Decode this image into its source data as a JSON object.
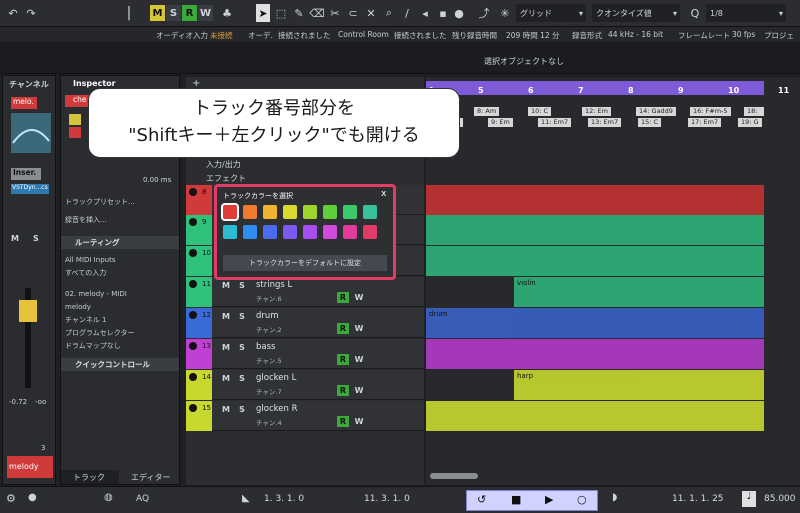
{
  "toolbar": {
    "m": "M",
    "s": "S",
    "r": "R",
    "w": "W",
    "grid": "グリッド",
    "quantize": "クオンタイズ値",
    "quantize_value": "1/8"
  },
  "status": {
    "audio_input_label": "オーディオ入力",
    "audio_input_value": "未接続",
    "audio_out_label": "オーデ.",
    "audio_out_value": "接続されました",
    "control_room_label": "Control Room",
    "control_room_value": "接続されました",
    "remaining_label": "残り録音時間",
    "remaining_value": "209 時間 12 分",
    "format_label": "録音形式",
    "format_value": "44 kHz - 16 bit",
    "framerate_label": "フレームレート",
    "framerate_value": "30 fps",
    "project_label": "プロジェクトの"
  },
  "info": {
    "no_selection": "選択オブジェクトなし"
  },
  "channel": {
    "title": "チャンネル",
    "name": "melo.",
    "insert": "Inser.",
    "plugin": "VSTDyn...cs",
    "volume": "-0.72",
    "pan": "-oo",
    "meter": "3",
    "track_name": "melody"
  },
  "inspector": {
    "title": "Inspector",
    "track_name": "che",
    "time": "0.00 ms",
    "preset": "トラックプリセット...",
    "pre_insert": "録音を挿入...",
    "routing": "ルーティング",
    "midi_in": "All MIDI Inputs",
    "all_inputs": "すべての入力",
    "midi_out": "02. melody - MIDI",
    "melody": "melody",
    "channel": "チャンネル 1",
    "program": "プログラムセレクター",
    "drum_map": "ドラムマップなし",
    "quick_controls": "クイックコントロール",
    "tab_track": "トラック",
    "tab_editor": "エディター"
  },
  "callout": {
    "line1": "トラック番号部分を",
    "line2": "\"Shiftキー＋左クリック\"でも開ける"
  },
  "picker": {
    "title": "トラックカラーを選択",
    "close": "x",
    "default_button": "トラックカラーをデフォルトに設定",
    "colors": [
      "#e23b3b",
      "#f07a2e",
      "#f0b32e",
      "#d9d92e",
      "#9fd62e",
      "#5bd03a",
      "#3ac86a",
      "#36c29a",
      "#2ebad0",
      "#2e8ef0",
      "#4a6af0",
      "#7a5af0",
      "#a84ef0",
      "#d04ae0",
      "#e23b9a",
      "#e23b66"
    ]
  },
  "rows": {
    "io": "入力/出力",
    "fx": "エフェクト"
  },
  "tracks": [
    {
      "num": "8",
      "name": "",
      "sub": "",
      "color": "#d03a3a"
    },
    {
      "num": "9",
      "name": "",
      "sub": "",
      "color": "#2ec27a"
    },
    {
      "num": "10",
      "name": "",
      "sub": "",
      "color": "#2ec27a"
    },
    {
      "num": "11",
      "name": "strings L",
      "sub": "チャン.6",
      "color": "#2ec27a"
    },
    {
      "num": "12",
      "name": "drum",
      "sub": "チャン.2",
      "color": "#3a6ad6"
    },
    {
      "num": "13",
      "name": "bass",
      "sub": "チャン.5",
      "color": "#c040d6"
    },
    {
      "num": "14",
      "name": "glocken L",
      "sub": "チャン.7",
      "color": "#c8d82e"
    },
    {
      "num": "15",
      "name": "glocken R",
      "sub": "チャン.4",
      "color": "#c8d82e"
    }
  ],
  "ruler": {
    "bars": [
      "4",
      "5",
      "6",
      "7",
      "8",
      "9",
      "10",
      "11"
    ]
  },
  "chords_top": [
    "8: Am",
    "10: C",
    "12: Em",
    "14: Gadd9",
    "16: F#m-5",
    "18: Am"
  ],
  "chords_bottom": [
    "7: Em",
    "9: Em",
    "11: Em7",
    "13: Em7",
    "15: C",
    "17: Em7",
    "19: G"
  ],
  "parts": {
    "violin": "violin",
    "drum": "drum",
    "harp": "harp"
  },
  "transport": {
    "pos_left": "1. 3. 1. 0",
    "pos_right": "11. 3. 1. 0",
    "pos_main": "11. 1. 1. 25",
    "tempo": "85.000",
    "aq": "AQ"
  }
}
